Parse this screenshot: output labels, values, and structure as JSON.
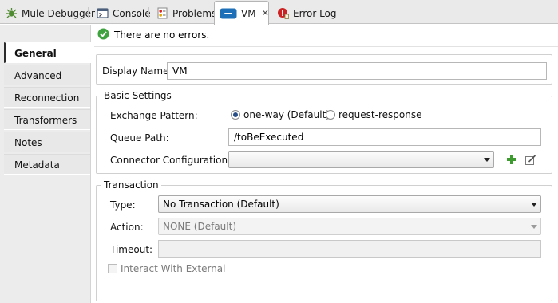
{
  "tabs": [
    {
      "label": "Mule Debugger",
      "icon": "bug-icon"
    },
    {
      "label": "Console",
      "icon": "console-icon"
    },
    {
      "label": "Problems",
      "icon": "problems-icon"
    },
    {
      "label": "VM",
      "icon": "vm-connector-icon",
      "active": true
    },
    {
      "label": "Error Log",
      "icon": "error-log-icon"
    }
  ],
  "nav": {
    "items": [
      "General",
      "Advanced",
      "Reconnection",
      "Transformers",
      "Notes",
      "Metadata"
    ],
    "active": "General"
  },
  "status": {
    "message": "There are no errors.",
    "icon": "ok-check-icon"
  },
  "display_name": {
    "label": "Display Name:",
    "value": "VM"
  },
  "basic": {
    "title": "Basic Settings",
    "exchange_label": "Exchange Pattern:",
    "options": [
      "one-way (Default)",
      "request-response"
    ],
    "selected": "one-way (Default)",
    "queue_label": "Queue Path:",
    "queue_value": "/toBeExecuted",
    "connector_label": "Connector Configuration:",
    "connector_value": ""
  },
  "transaction": {
    "title": "Transaction",
    "type_label": "Type:",
    "type_value": "No Transaction (Default)",
    "action_label": "Action:",
    "action_value": "NONE (Default)",
    "timeout_label": "Timeout:",
    "timeout_value": "",
    "interact_label": "Interact With External"
  },
  "colors": {
    "accent": "#1d6fb8",
    "ok_green": "#3ea33e",
    "add_green": "#3d9b2f",
    "error_red": "#cc2222"
  }
}
